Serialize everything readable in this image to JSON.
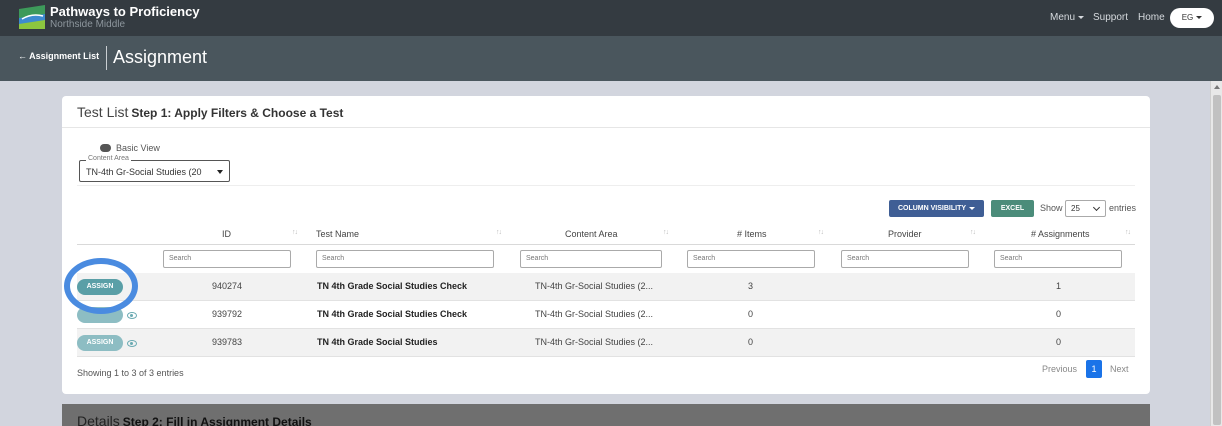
{
  "nav": {
    "brand_title": "Pathways to Proficiency",
    "brand_subtitle": "Northside Middle",
    "menu": "Menu",
    "support": "Support",
    "home": "Home",
    "user_initials": "EG"
  },
  "header": {
    "back_label": "Assignment List",
    "title": "Assignment"
  },
  "test_list": {
    "title": "Test List",
    "step": "Step 1: Apply Filters & Choose a Test",
    "view_toggle_label": "Basic View",
    "content_area_label": "Content Area",
    "content_area_value": "TN-4th Gr-Social Studies (20",
    "column_visibility_label": "COLUMN VISIBILITY",
    "excel_label": "EXCEL",
    "show_label": "Show",
    "page_size": "25",
    "entries_label": "entries",
    "search_placeholder": "Search",
    "columns": [
      "ID",
      "Test Name",
      "Content Area",
      "# Items",
      "Provider",
      "# Assignments"
    ],
    "assign_label": "ASSIGN",
    "rows": [
      {
        "id": "940274",
        "name": "TN 4th Grade Social Studies Check",
        "area": "TN-4th Gr-Social Studies (2...",
        "items": "3",
        "provider": "",
        "assignments": "1"
      },
      {
        "id": "939792",
        "name": "TN 4th Grade Social Studies Check",
        "area": "TN-4th Gr-Social Studies (2...",
        "items": "0",
        "provider": "",
        "assignments": "0"
      },
      {
        "id": "939783",
        "name": "TN 4th Grade Social Studies",
        "area": "TN-4th Gr-Social Studies (2...",
        "items": "0",
        "provider": "",
        "assignments": "0"
      }
    ],
    "showing_info": "Showing 1 to 3 of 3 entries",
    "pagination": {
      "previous": "Previous",
      "current": "1",
      "next": "Next"
    }
  },
  "details": {
    "title": "Details",
    "step": "Step 2: Fill in Assignment Details"
  },
  "colors": {
    "nav_bg": "#343b41",
    "header_bg": "#4a565d",
    "assign_button": "#5a9fa7",
    "column_visibility_button": "#3f5e95",
    "excel_button": "#4b8c7a",
    "highlight_ring": "#4a8be0",
    "active_page": "#1a73e8"
  }
}
